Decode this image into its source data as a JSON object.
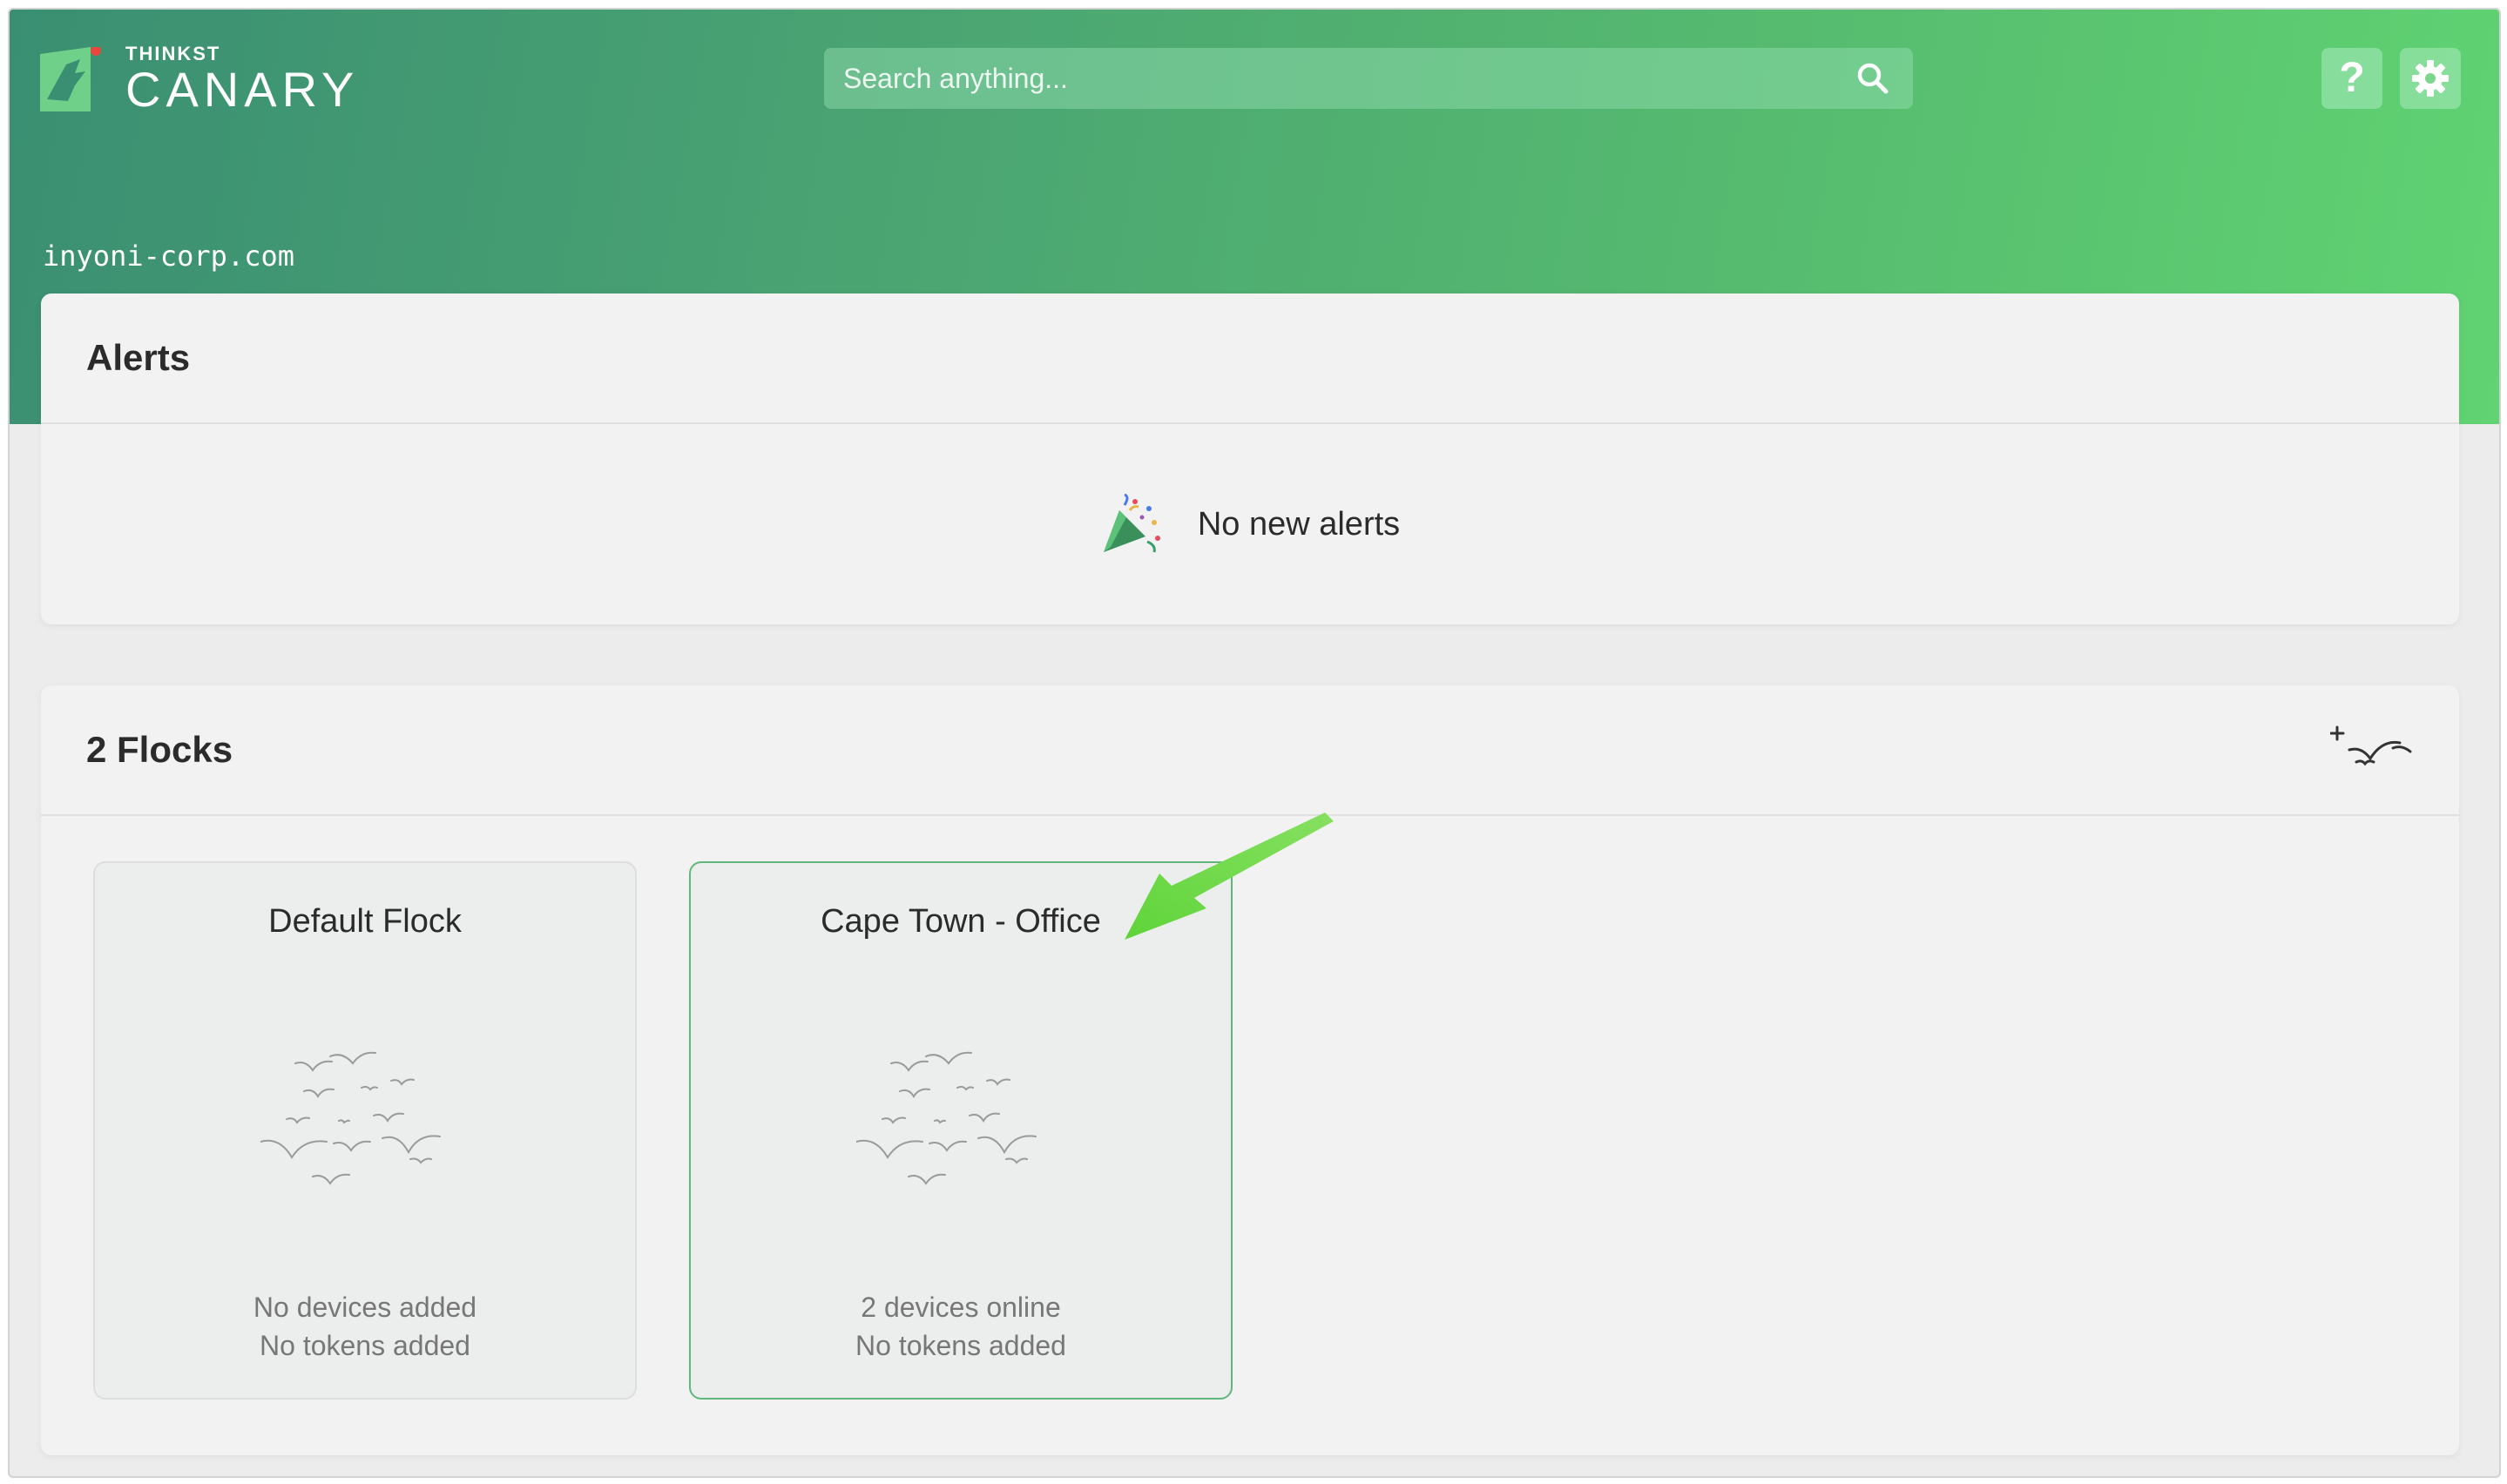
{
  "header": {
    "logo_small": "THINKST",
    "logo_big": "CANARY",
    "search_placeholder": "Search anything...",
    "help_label": "?",
    "domain": "inyoni-corp.com"
  },
  "alerts": {
    "title": "Alerts",
    "empty_message": "No new alerts"
  },
  "flocks": {
    "title": "2 Flocks",
    "items": [
      {
        "name": "Default Flock",
        "devices": "No devices added",
        "tokens": "No tokens added",
        "selected": false
      },
      {
        "name": "Cape Town - Office",
        "devices": "2 devices online",
        "tokens": "No tokens added",
        "selected": true
      }
    ]
  },
  "colors": {
    "header_gradient_start": "#3a8f72",
    "header_gradient_end": "#60d372",
    "selected_border": "#5fb87a",
    "annotation_arrow": "#6cd64a"
  }
}
